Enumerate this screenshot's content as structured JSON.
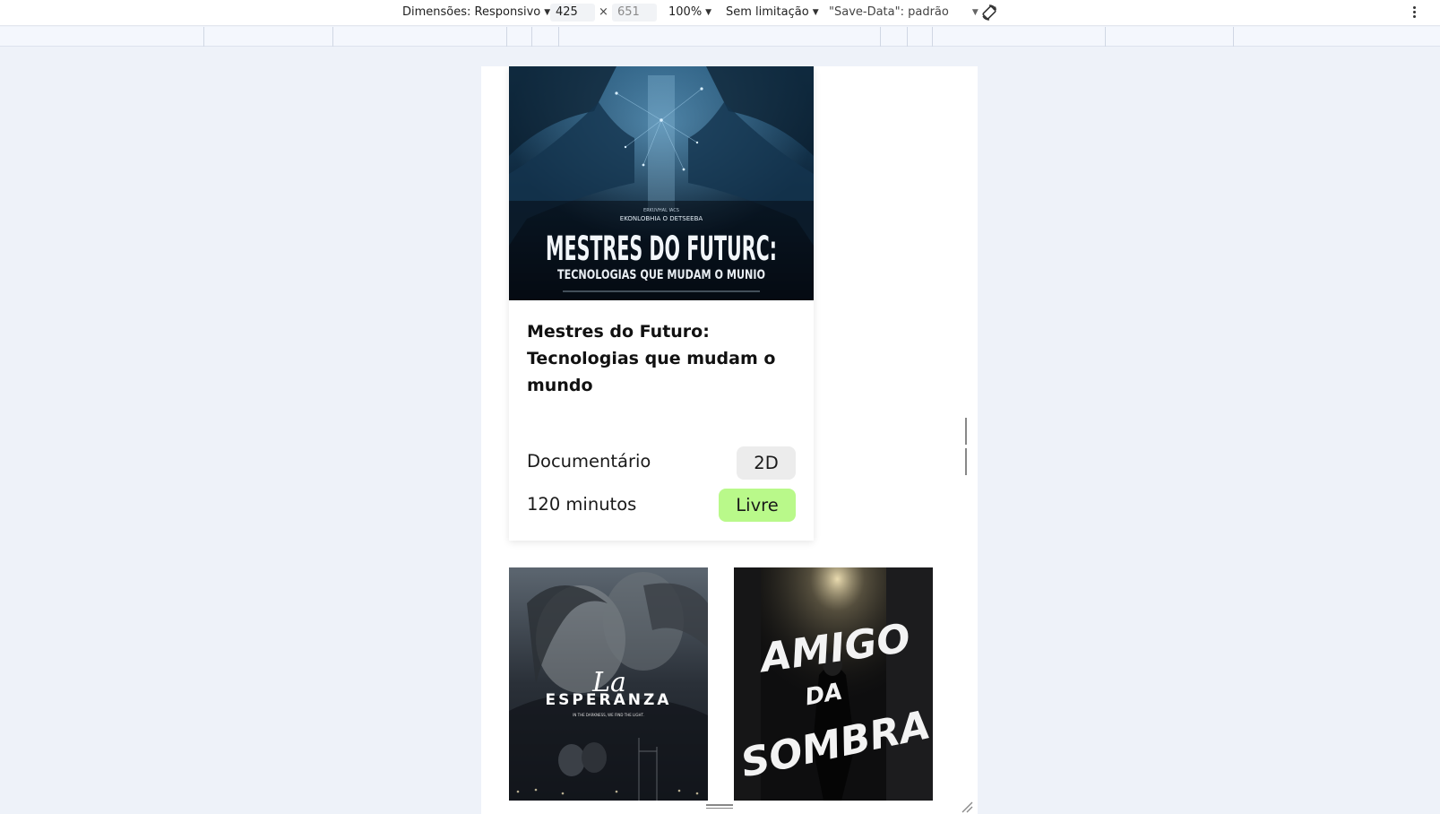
{
  "toolbar": {
    "dimensions_label": "Dimensões: Responsivo",
    "width_value": "425",
    "height_placeholder": "651",
    "times": "×",
    "zoom": "100%",
    "throttle": "Sem limitação",
    "save_data": "\"Save-Data\": padrão"
  },
  "featured": {
    "poster": {
      "small_credit": "ERKUVHAL IACS",
      "tagline": "EKONLOBHIA O DETSEEBA",
      "title_line1": "MESTRES DO FUTURC:",
      "title_line2": "TECNOLOGIAS QUE MUDAM O MUNIO"
    },
    "title": "Mestres do Futuro: Tecnologias que mudam o mundo",
    "genre": "Documentário",
    "format": "2D",
    "duration": "120 minutos",
    "rating": "Livre"
  },
  "movies": [
    {
      "poster_script": "La",
      "poster_title": "ESPERANZA",
      "poster_tagline": "IN THE DARKNESS, WE FIND THE LIGHT."
    },
    {
      "poster_title_line1": "AMIGO",
      "poster_title_line2": "DA",
      "poster_title_line3": "SOMBRA"
    }
  ],
  "colors": {
    "rating_badge": "#b9f98a",
    "format_badge": "#ececec",
    "page_bg": "#eef2f9"
  }
}
